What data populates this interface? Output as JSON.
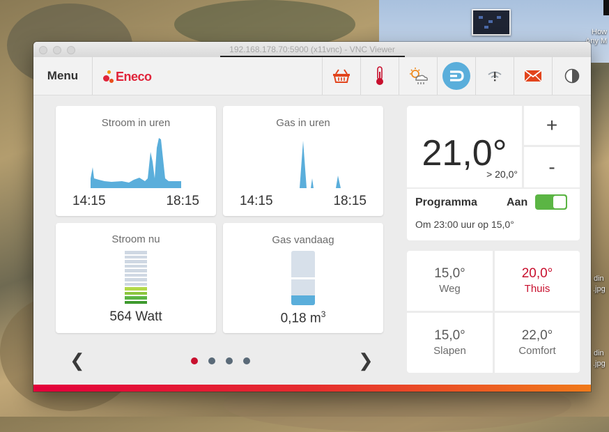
{
  "window": {
    "title": "192.168.178.70:5900 (x11vnc) - VNC Viewer"
  },
  "desktop": {
    "labels": [
      "How",
      "Any M",
      "din",
      ".jpg",
      "din",
      ".jpg"
    ]
  },
  "header": {
    "menu_label": "Menu",
    "logo_text": "Eneco",
    "icons": [
      "basket-icon",
      "thermometer-icon",
      "weather-icon",
      "display-icon",
      "wifi-alert-icon",
      "mail-icon",
      "contrast-icon"
    ]
  },
  "tiles": {
    "stroom_uren": {
      "title": "Stroom in uren",
      "start": "14:15",
      "end": "18:15"
    },
    "gas_uren": {
      "title": "Gas in uren",
      "start": "14:15",
      "end": "18:15"
    },
    "stroom_nu": {
      "title": "Stroom nu",
      "value": "564 Watt",
      "level_bars": 4,
      "total_bars": 12
    },
    "gas_vandaag": {
      "title": "Gas vandaag",
      "value": "0,18 m",
      "unit_sup": "3",
      "fill_fraction": 0.18
    }
  },
  "pager": {
    "dots": 4,
    "active": 0
  },
  "thermostat": {
    "current_temp": "21,0°",
    "setpoint": "> 20,0°",
    "plus_label": "+",
    "minus_label": "-",
    "program_label": "Programma",
    "program_state": "Aan",
    "program_on": true,
    "program_info": "Om 23:00 uur op 15,0°"
  },
  "presets": [
    {
      "temp": "15,0°",
      "name": "Weg",
      "active": false
    },
    {
      "temp": "20,0°",
      "name": "Thuis",
      "active": true
    },
    {
      "temp": "15,0°",
      "name": "Slapen",
      "active": false
    },
    {
      "temp": "22,0°",
      "name": "Comfort",
      "active": false
    }
  ],
  "colors": {
    "accent_blue": "#5aaedb",
    "active_red": "#c8102e",
    "toggle_green": "#5bb544",
    "meter_green": [
      "#3f9a2f",
      "#5bb544",
      "#8cc63f",
      "#b3d94a"
    ],
    "meter_grey": "#cfd8e3"
  }
}
